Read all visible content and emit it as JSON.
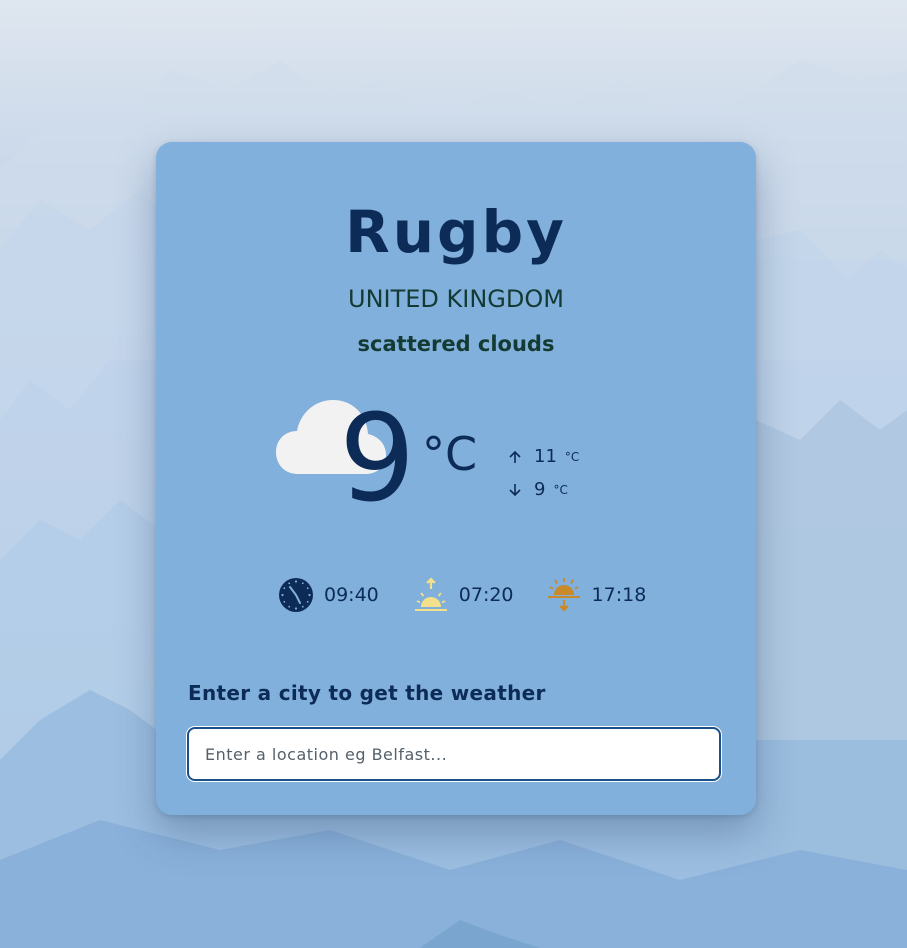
{
  "weather": {
    "city": "Rugby",
    "country": "UNITED KINGDOM",
    "description": "scattered clouds",
    "temperature": "9",
    "temperature_unit": "°C",
    "max_temp": "11",
    "min_temp": "9",
    "minmax_unit": "°C",
    "icon": "cloud-icon"
  },
  "times": {
    "local_time": "09:40",
    "sunrise": "07:20",
    "sunset": "17:18",
    "icons": [
      "clock-icon",
      "sunrise-icon",
      "sunset-icon"
    ]
  },
  "search": {
    "label": "Enter a city to get the weather",
    "placeholder": "Enter a location eg Belfast...",
    "value": ""
  },
  "colors": {
    "card": "#80b0db",
    "text_primary": "#0d2b57",
    "text_secondary": "#143a34",
    "sunrise": "#f3e08a",
    "sunset": "#c98a2a"
  }
}
